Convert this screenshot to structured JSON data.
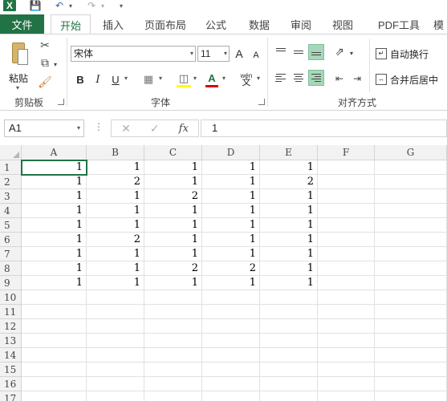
{
  "quick_access": {
    "logo": "X",
    "save_icon": "save-icon",
    "undo_icon": "undo-icon",
    "redo_icon": "redo-icon",
    "more": "="
  },
  "tabs": [
    {
      "label": "文件"
    },
    {
      "label": "开始"
    },
    {
      "label": "插入"
    },
    {
      "label": "页面布局"
    },
    {
      "label": "公式"
    },
    {
      "label": "数据"
    },
    {
      "label": "审阅"
    },
    {
      "label": "视图"
    },
    {
      "label": "PDF工具"
    },
    {
      "label": "模"
    }
  ],
  "ribbon": {
    "clipboard": {
      "paste_label": "粘贴",
      "group_label": "剪贴板"
    },
    "font": {
      "font_name": "宋体",
      "font_size": "11",
      "bold": "B",
      "italic": "I",
      "underline": "U",
      "grow": "A",
      "shrink": "A",
      "font_color": "A",
      "pinyin": "wén",
      "pinyin_char": "文",
      "group_label": "字体"
    },
    "alignment": {
      "wrap_label": "自动换行",
      "merge_label": "合并后居中",
      "group_label": "对齐方式"
    }
  },
  "formula_bar": {
    "name_box": "A1",
    "cancel": "✕",
    "enter": "✓",
    "fx": "fx",
    "formula": "1"
  },
  "sheet": {
    "columns": [
      "A",
      "B",
      "C",
      "D",
      "E",
      "F",
      "G"
    ],
    "rows": [
      "1",
      "2",
      "3",
      "4",
      "5",
      "6",
      "7",
      "8",
      "9",
      "10",
      "11",
      "12",
      "13",
      "14",
      "15",
      "16",
      "17"
    ],
    "values": [
      [
        "1",
        "1",
        "1",
        "1",
        "1"
      ],
      [
        "1",
        "2",
        "1",
        "1",
        "2"
      ],
      [
        "1",
        "1",
        "2",
        "1",
        "1"
      ],
      [
        "1",
        "1",
        "1",
        "1",
        "1"
      ],
      [
        "1",
        "1",
        "1",
        "1",
        "1"
      ],
      [
        "1",
        "2",
        "1",
        "1",
        "1"
      ],
      [
        "1",
        "1",
        "1",
        "1",
        "1"
      ],
      [
        "1",
        "1",
        "2",
        "2",
        "1"
      ],
      [
        "1",
        "1",
        "1",
        "1",
        "1"
      ]
    ]
  },
  "colors": {
    "accent": "#217346",
    "selected_align": "#a7d7b8"
  }
}
